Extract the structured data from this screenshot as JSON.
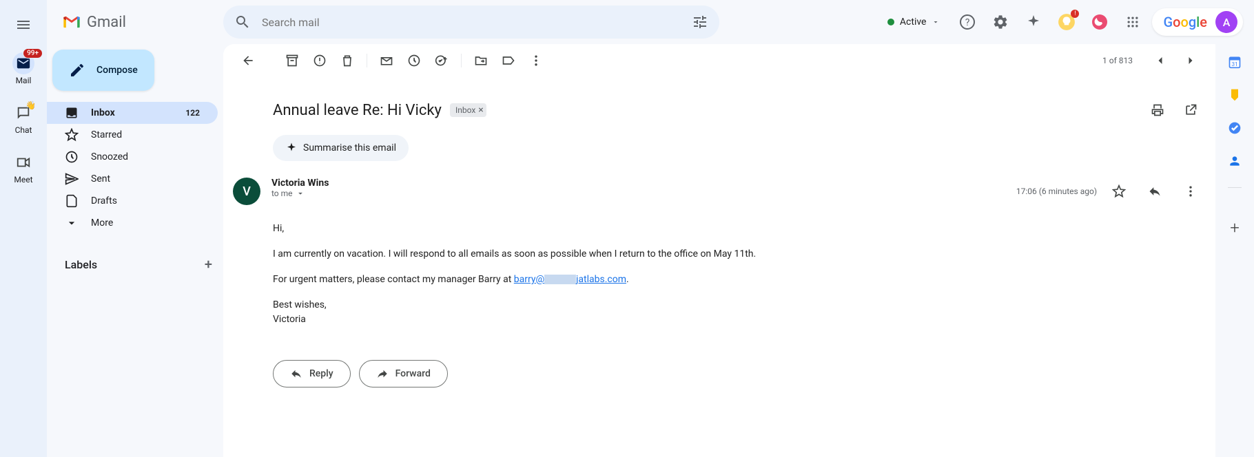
{
  "app": {
    "name": "Gmail"
  },
  "header": {
    "search_placeholder": "Search mail",
    "status": "Active",
    "google_text": "Google",
    "avatar_letter": "A"
  },
  "leftRail": {
    "mail_badge": "99+",
    "items": [
      {
        "label": "Mail"
      },
      {
        "label": "Chat"
      },
      {
        "label": "Meet"
      }
    ]
  },
  "sidebar": {
    "compose": "Compose",
    "items": [
      {
        "label": "Inbox",
        "count": "122"
      },
      {
        "label": "Starred"
      },
      {
        "label": "Snoozed"
      },
      {
        "label": "Sent"
      },
      {
        "label": "Drafts"
      },
      {
        "label": "More"
      }
    ],
    "labels_header": "Labels"
  },
  "toolbar": {
    "pager": "1 of 813"
  },
  "message": {
    "subject": "Annual leave Re: Hi Vicky",
    "chip": "Inbox",
    "summarise": "Summarise this email",
    "sender_name": "Victoria Wins",
    "sender_initial": "V",
    "to_text": "to me",
    "timestamp": "17:06 (6 minutes ago)",
    "body": {
      "greeting": "Hi,",
      "line1": "I am currently on vacation. I will respond to all emails as soon as possible when I return to the office on May 11th.",
      "line2_prefix": "For urgent matters, please contact my manager Barry at ",
      "email_part1": "barry@",
      "email_part2": "jatlabs.com",
      "line2_suffix": ".",
      "closing": "Best wishes,",
      "signature": "Victoria"
    },
    "reply": "Reply",
    "forward": "Forward"
  }
}
